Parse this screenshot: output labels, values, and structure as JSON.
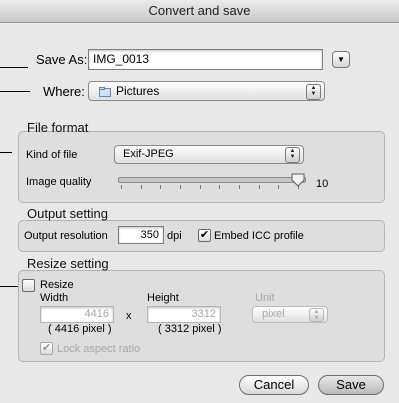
{
  "window": {
    "title": "Convert and save"
  },
  "save_as": {
    "label": "Save As:",
    "value": "IMG_0013"
  },
  "where": {
    "label": "Where:",
    "value": "Pictures"
  },
  "file_format": {
    "section_title": "File format",
    "kind_label": "Kind of file",
    "kind_value": "Exif-JPEG",
    "quality_label": "Image quality",
    "quality_value": "10",
    "quality_min": 1,
    "quality_max": 10
  },
  "output_setting": {
    "section_title": "Output setting",
    "resolution_label": "Output resolution",
    "resolution_value": "350",
    "resolution_unit": "dpi",
    "embed_icc_label": "Embed ICC profile",
    "embed_icc_checked": true
  },
  "resize_setting": {
    "section_title": "Resize setting",
    "resize_label": "Resize",
    "resize_checked": false,
    "width_label": "Width",
    "width_value": "4416",
    "width_pixel": "( 4416 pixel )",
    "times": "x",
    "height_label": "Height",
    "height_value": "3312",
    "height_pixel": "( 3312 pixel )",
    "unit_label": "Unit",
    "unit_value": "pixel",
    "lock_label": "Lock aspect ratio",
    "lock_checked": true
  },
  "buttons": {
    "cancel": "Cancel",
    "save": "Save"
  }
}
